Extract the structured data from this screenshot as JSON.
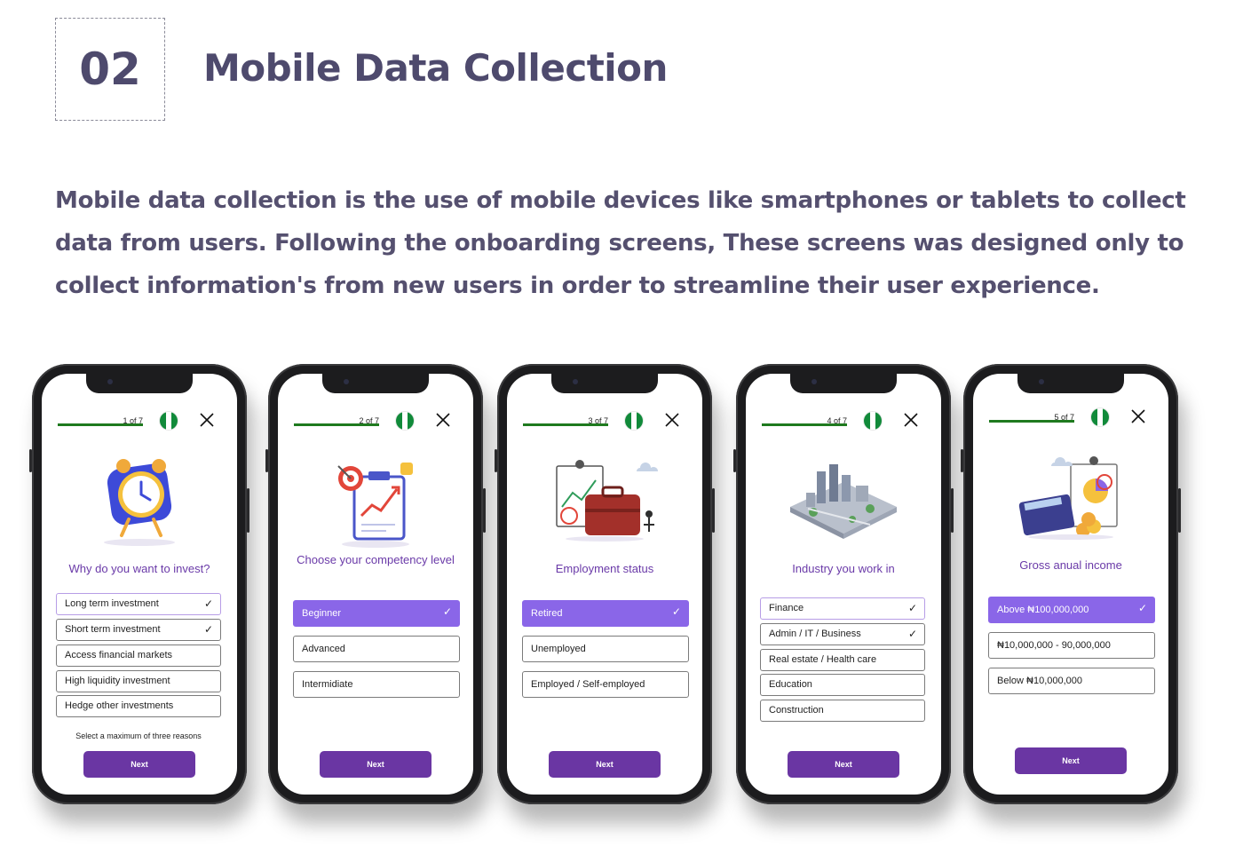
{
  "header": {
    "number": "02",
    "title": "Mobile Data Collection",
    "intro": "Mobile data collection is the use of mobile devices like smartphones or tablets to collect data from users.  Following the onboarding screens, These screens was designed only to collect information's from new users in order to streamline their user experience."
  },
  "colors": {
    "accent": "#6a36a3",
    "selected_fill": "#8a66e8",
    "progress": "#1f7a1f",
    "flag_green": "#118a3a",
    "heading": "#4e4a6d"
  },
  "phones": [
    {
      "step": "1 of 7",
      "question": "Why do you want to invest?",
      "illustration": "alarm-clock-illustration",
      "options": [
        {
          "label": "Long term investment",
          "check": "✓"
        },
        {
          "label": "Short term investment",
          "check": "✓"
        },
        {
          "label": "Access financial markets"
        },
        {
          "label": "High liquidity investment"
        },
        {
          "label": "Hedge other investments"
        }
      ],
      "hint": "Select a maximum of three reasons",
      "next": "Next"
    },
    {
      "step": "2 of 7",
      "question": "Choose your competency level",
      "illustration": "target-growth-chart-illustration",
      "options": [
        {
          "label": "Beginner",
          "check": "✓"
        },
        {
          "label": "Advanced"
        },
        {
          "label": "Intermidiate"
        }
      ],
      "next": "Next"
    },
    {
      "step": "3 of 7",
      "question": "Employment status",
      "illustration": "briefcase-team-illustration",
      "options": [
        {
          "label": "Retired",
          "check": "✓"
        },
        {
          "label": "Unemployed"
        },
        {
          "label": "Employed / Self-employed"
        }
      ],
      "next": "Next"
    },
    {
      "step": "4 of 7",
      "question": "Industry you work in",
      "illustration": "isometric-city-illustration",
      "options": [
        {
          "label": "Finance",
          "check": "✓"
        },
        {
          "label": "Admin / IT / Business",
          "check": "✓"
        },
        {
          "label": "Real estate / Health care"
        },
        {
          "label": "Education"
        },
        {
          "label": "Construction"
        }
      ],
      "next": "Next"
    },
    {
      "step": "5 of 7",
      "question": "Gross anual income",
      "illustration": "calculator-coins-illustration",
      "options": [
        {
          "label": "Above ₦100,000,000",
          "check": "✓"
        },
        {
          "label": "₦10,000,000 - 90,000,000"
        },
        {
          "label": "Below ₦10,000,000"
        }
      ],
      "next": "Next"
    }
  ]
}
